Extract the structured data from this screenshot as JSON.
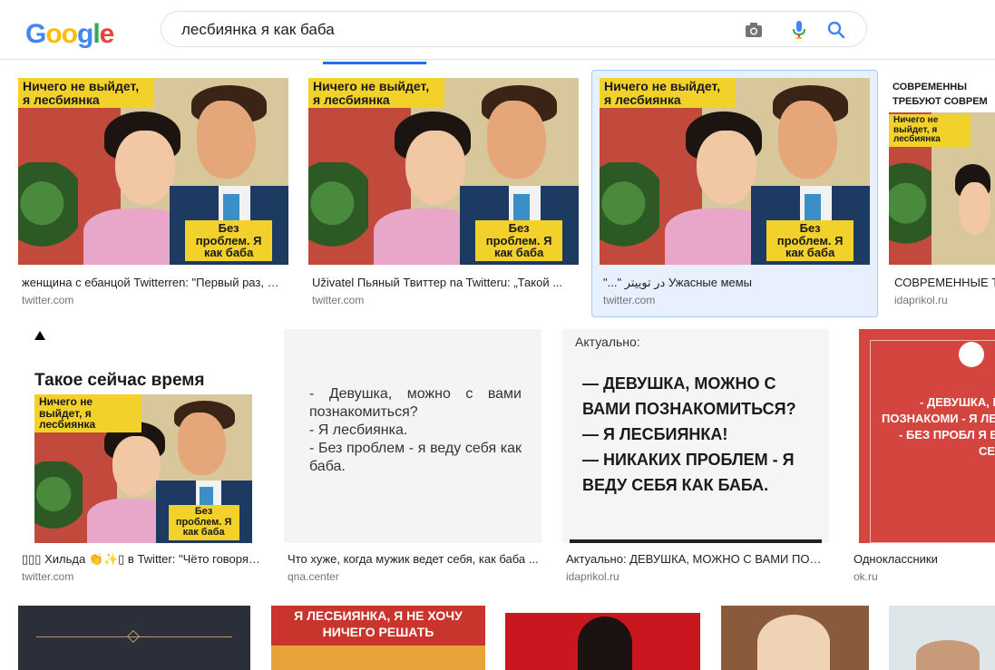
{
  "header": {
    "logo_letters": [
      "G",
      "o",
      "o",
      "g",
      "l",
      "e"
    ],
    "search_query": "лесбиянка я как баба"
  },
  "icons": [
    "camera-icon",
    "microphone-icon",
    "search-icon"
  ],
  "results": [
    {
      "title": "женщина с ебанцой Twitterren: \"Первый раз, Ничего не выйдет...",
      "source": "twitter.com",
      "art": {
        "top_text": "Ничего не выйдет, я лесбиянка",
        "bottom_text": "Без проблем. Я как баба"
      }
    },
    {
      "title": "Uživatel Пьяный Твиттер na Twitteru: „Такой ...",
      "source": "twitter.com",
      "art": {
        "top_text": "Ничего не выйдет, я лесбиянка",
        "bottom_text": "Без проблем. Я как баба"
      }
    },
    {
      "title": "\"...\" در توییتر Ужасные мемы",
      "source": "twitter.com",
      "art": {
        "top_text": "Ничего не выйдет, я лесбиянка",
        "bottom_text": "Без проблем. Я как баба"
      }
    },
    {
      "title": "СОВРЕМЕННЫЕ Т",
      "source": "idaprikol.ru",
      "art": {
        "header_text": "СОВРЕМЕННЫ ТРЕБУЮТ СОВРЕМ",
        "top_text": "Ничего не выйдет, я лесбиянка"
      }
    },
    {
      "title": "▯▯▯ Хильда 👏✨▯ в Twitter: \"Чёто говорят ...",
      "source": "twitter.com",
      "art": {
        "post_title": "Такое сейчас время",
        "top_text": "Ничего не выйдет, я лесбиянка",
        "bottom_text": "Без проблем. Я как баба"
      }
    },
    {
      "title": "Что хуже, когда мужик ведет себя, как баба ...",
      "source": "qna.center",
      "art": {
        "text": "- Девушка, можно с вами познакомиться?\n- Я лесбиянка.\n- Без проблем - я веду себя как баба."
      }
    },
    {
      "title": "Актуально: ДЕВУШКА, МОЖНО С ВАМИ ПОЗНАКОМИТЬСЯ?",
      "source": "idaprikol.ru",
      "art": {
        "head": "Актуально:",
        "text": "— ДЕВУШКА, МОЖНО С ВАМИ ПОЗНАКОМИТЬСЯ?\n— Я ЛЕСБИЯНКА!\n— НИКАКИХ ПРОБЛЕМ - Я ВЕДУ СЕБЯ КАК БАБА."
      }
    },
    {
      "title": "Одноклассники",
      "source": "ok.ru",
      "art": {
        "text": "- ДЕВУШКА, МОЖ ПОЗНАКОМИ - Я ЛЕСБИ - БЕЗ ПРОБЛ Я ВЕДУ СЕБЯ К"
      }
    }
  ],
  "partial_row": {
    "poster_text": "Я ЛЕСБИЯНКА, Я НЕ ХОЧУ НИЧЕГО РЕШАТЬ"
  },
  "colors": {
    "accent": "#1a73e8",
    "selected_bg": "#e8f0fe",
    "comic_yellow": "#f2d12a",
    "red_meme": "#d5453f"
  }
}
